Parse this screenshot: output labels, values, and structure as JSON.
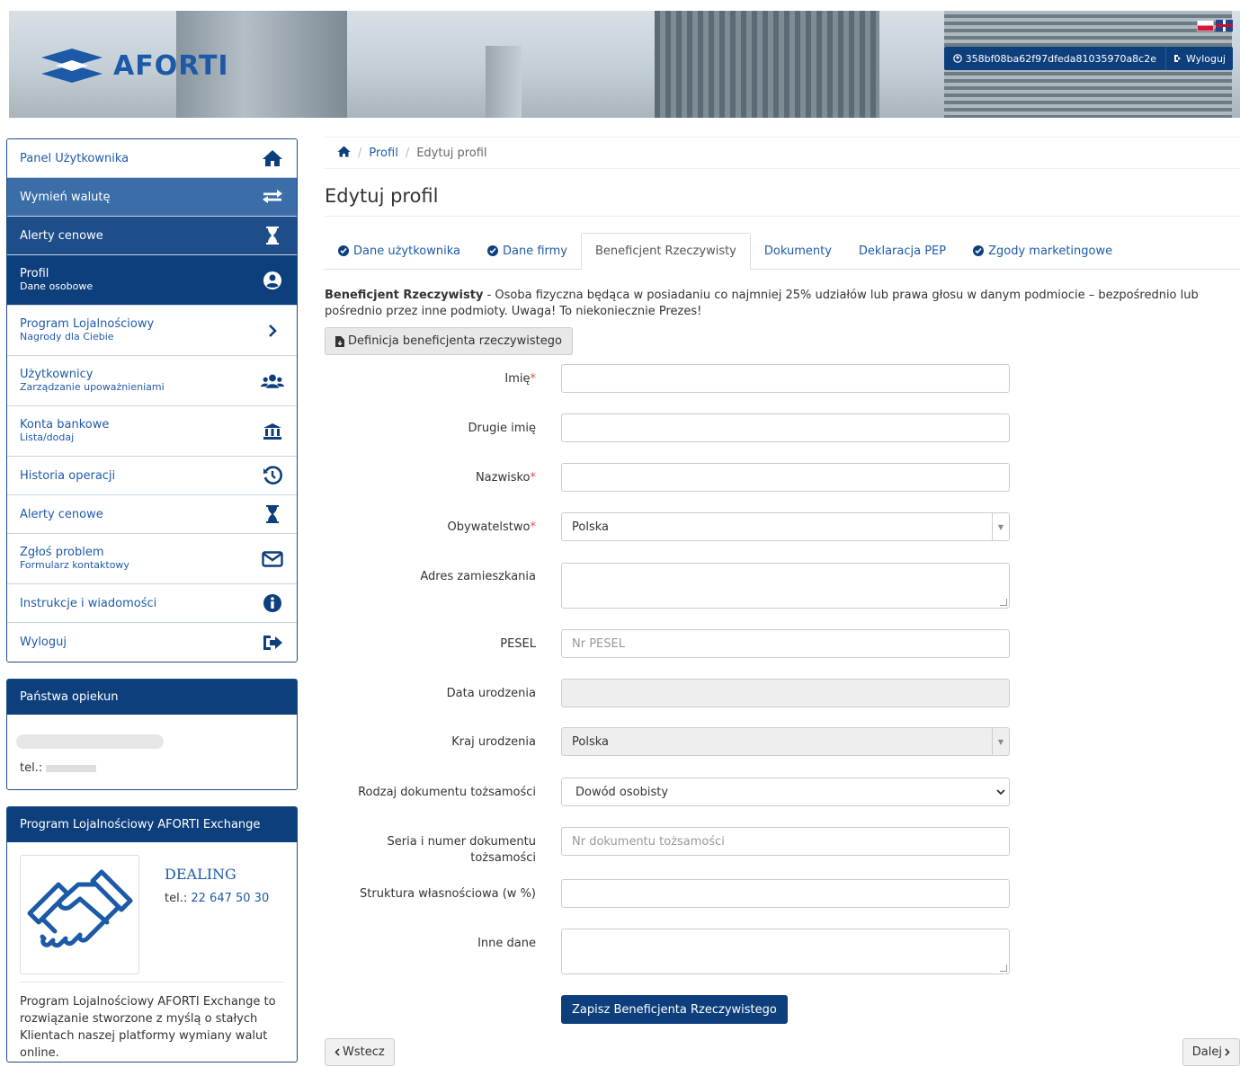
{
  "header": {
    "logo_text": "AFORTI",
    "user_id": "358bf08ba62f97dfeda81035970a8c2e",
    "logout_label": "Wyloguj"
  },
  "sidebar": {
    "items": [
      {
        "label": "Panel Użytkownika",
        "sub": "",
        "icon": "home-icon"
      },
      {
        "label": "Wymień walutę",
        "sub": "",
        "icon": "exchange-icon"
      },
      {
        "label": "Alerty cenowe",
        "sub": "",
        "icon": "hourglass-icon"
      },
      {
        "label": "Profil",
        "sub": "Dane osobowe",
        "icon": "user-circle-icon"
      },
      {
        "label": "Program Lojalnościowy",
        "sub": "Nagrody dla Ciebie",
        "icon": "chevron-right-icon"
      },
      {
        "label": "Użytkownicy",
        "sub": "Zarządzanie upoważnieniami",
        "icon": "users-icon"
      },
      {
        "label": "Konta bankowe",
        "sub": "Lista/dodaj",
        "icon": "bank-icon"
      },
      {
        "label": "Historia operacji",
        "sub": "",
        "icon": "history-icon"
      },
      {
        "label": "Alerty cenowe",
        "sub": "",
        "icon": "hourglass-icon"
      },
      {
        "label": "Zgłoś problem",
        "sub": "Formularz kontaktowy",
        "icon": "envelope-icon"
      },
      {
        "label": "Instrukcje i wiadomości",
        "sub": "",
        "icon": "info-icon"
      },
      {
        "label": "Wyloguj",
        "sub": "",
        "icon": "sign-out-icon"
      }
    ],
    "guardian": {
      "title": "Państwa opiekun",
      "tel_label": "tel.:"
    },
    "loyalty": {
      "title": "Program Lojalnościowy AFORTI Exchange",
      "dealing": "DEALING",
      "tel_label": "tel.:",
      "tel_value": "22 647 50 30",
      "description": "Program Lojalnościowy AFORTI Exchange to rozwiązanie stworzone z myślą o stałych Klientach naszej platformy wymiany walut online."
    }
  },
  "breadcrumb": {
    "profile": "Profil",
    "current": "Edytuj profil"
  },
  "page_title": "Edytuj profil",
  "tabs": [
    {
      "label": "Dane użytkownika",
      "check": true
    },
    {
      "label": "Dane firmy",
      "check": true
    },
    {
      "label": "Beneficjent Rzeczywisty",
      "check": false
    },
    {
      "label": "Dokumenty",
      "check": false
    },
    {
      "label": "Deklaracja PEP",
      "check": false
    },
    {
      "label": "Zgody marketingowe",
      "check": true
    }
  ],
  "description": {
    "bold": "Beneficjent Rzeczywisty",
    "text": " - Osoba fizyczna będąca w posiadaniu co najmniej 25% udziałów lub prawa głosu w danym podmiocie – bezpośrednio lub pośrednio przez inne podmioty. Uwaga! To niekoniecznie Prezes!"
  },
  "definition_button": "Definicja beneficjenta rzeczywistego",
  "form": {
    "first_name": {
      "label": "Imię",
      "value": ""
    },
    "second_name": {
      "label": "Drugie imię",
      "value": ""
    },
    "last_name": {
      "label": "Nazwisko",
      "value": ""
    },
    "citizenship": {
      "label": "Obywatelstwo",
      "value": "Polska"
    },
    "address": {
      "label": "Adres zamieszkania",
      "value": ""
    },
    "pesel": {
      "label": "PESEL",
      "placeholder": "Nr PESEL"
    },
    "birth_date": {
      "label": "Data urodzenia",
      "value": ""
    },
    "birth_country": {
      "label": "Kraj urodzenia",
      "value": "Polska"
    },
    "doc_type": {
      "label": "Rodzaj dokumentu tożsamości",
      "value": "Dowód osobisty"
    },
    "doc_number": {
      "label_1": "Seria i numer dokumentu",
      "label_2": "tożsamości",
      "placeholder": "Nr dokumentu tożsamości"
    },
    "ownership": {
      "label": "Struktura własnościowa (w %)",
      "value": ""
    },
    "other": {
      "label": "Inne dane",
      "value": ""
    },
    "required_mark": "*"
  },
  "save_button": "Zapisz Beneficjenta Rzeczywistego",
  "back_button": "Wstecz",
  "next_button": "Dalej"
}
